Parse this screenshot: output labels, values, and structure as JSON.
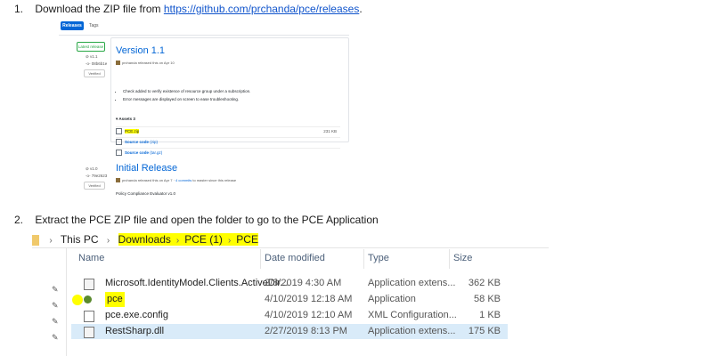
{
  "step1": {
    "num": "1.",
    "text": "Download the ZIP file from ",
    "link": "https://github.com/prchanda/pce/releases",
    "after": "."
  },
  "github": {
    "tabs": [
      "Releases",
      "Tags"
    ],
    "latest_badge": "Latest release",
    "release1": {
      "tag": "v1.1",
      "commit": "08b6b1e",
      "verified": "Verified",
      "title": "Version 1.1",
      "meta": "prchanda released this on Apr 10",
      "notes": [
        "Check added to verify existence of resource group under a subscription.",
        "Error messages are displayed on screen to ease troubleshooting."
      ],
      "assets_heading": "Assets 3",
      "assets": [
        {
          "name": "PCE.zip",
          "size": "231 KB"
        },
        {
          "name": "Source code",
          "suffix": "(zip)"
        },
        {
          "name": "Source code",
          "suffix": "(tar.gz)"
        }
      ]
    },
    "release2": {
      "tag": "v1.0",
      "commit": "79e2623",
      "verified": "Verified",
      "title": "Initial Release",
      "meta_before": "prchanda released this on Apr 7 · ",
      "meta_link": "4 commits",
      "meta_after": " to master since this release",
      "body": "Policy Compliance Evaluator v1.0"
    }
  },
  "step2": {
    "num": "2.",
    "text": "Extract the PCE ZIP file and open the folder to go to the PCE Application"
  },
  "explorer": {
    "breadcrumb": [
      "This PC",
      "Downloads",
      "PCE (1)",
      "PCE"
    ],
    "columns": [
      "Name",
      "Date modified",
      "Type",
      "Size"
    ],
    "rows": [
      {
        "name": "Microsoft.IdentityModel.Clients.ActiveDir...",
        "date": "2/8/2019 4:30 AM",
        "type": "Application extens...",
        "size": "362 KB",
        "icon": "dll-file-icon"
      },
      {
        "name": "pce",
        "date": "4/10/2019 12:18 AM",
        "type": "Application",
        "size": "58 KB",
        "icon": "application-icon"
      },
      {
        "name": "pce.exe.config",
        "date": "4/10/2019 12:10 AM",
        "type": "XML Configuration...",
        "size": "1 KB",
        "icon": "config-file-icon"
      },
      {
        "name": "RestSharp.dll",
        "date": "2/27/2019 8:13 PM",
        "type": "Application extens...",
        "size": "175 KB",
        "icon": "dll-file-icon"
      }
    ]
  }
}
